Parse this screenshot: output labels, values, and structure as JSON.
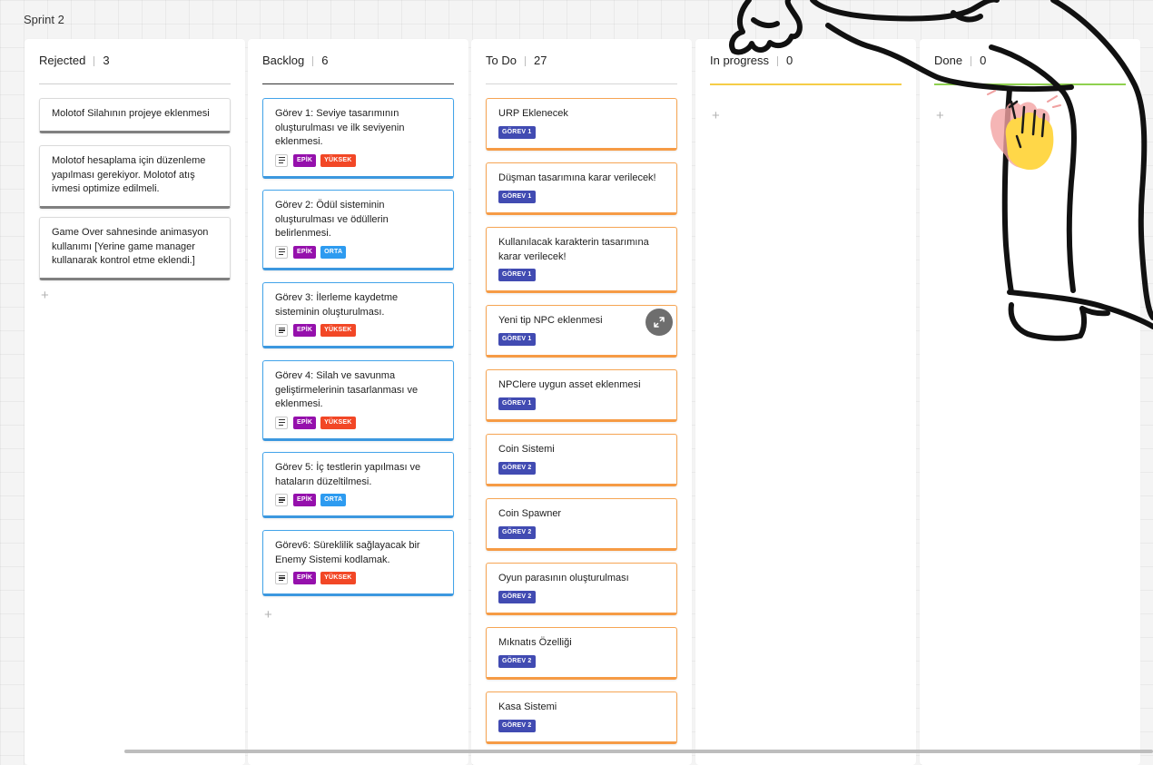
{
  "board": {
    "title": "Sprint 2"
  },
  "columns": [
    {
      "name": "Rejected",
      "count": "3",
      "cards": [
        {
          "title": "Molotof Silahının projeye eklenmesi"
        },
        {
          "title": "Molotof hesaplama için düzenleme yapılması gerekiyor. Molotof atış ivmesi optimize edilmeli."
        },
        {
          "title": "Game Over sahnesinde animasyon kullanımı [Yerine game manager kullanarak kontrol etme eklendi.]"
        }
      ]
    },
    {
      "name": "Backlog",
      "count": "6",
      "cards": [
        {
          "title": "Görev 1: Seviye tasarımının oluşturulması ve ilk seviyenin eklenmesi.",
          "tags": [
            "EPİK",
            "YÜKSEK"
          ]
        },
        {
          "title": "Görev 2: Ödül sisteminin oluşturulması ve ödüllerin belirlenmesi.",
          "tags": [
            "EPİK",
            "ORTA"
          ]
        },
        {
          "title": "Görev 3: İlerleme kaydetme sisteminin oluşturulması.",
          "tags": [
            "EPİK",
            "YÜKSEK"
          ]
        },
        {
          "title": "Görev 4: Silah ve savunma geliştirmelerinin tasarlanması ve eklenmesi.",
          "tags": [
            "EPİK",
            "YÜKSEK"
          ]
        },
        {
          "title": "Görev 5: İç testlerin yapılması ve hataların düzeltilmesi.",
          "tags": [
            "EPİK",
            "ORTA"
          ]
        },
        {
          "title": "Görev6: Süreklilik sağlayacak bir Enemy Sistemi kodlamak.",
          "tags": [
            "EPİK",
            "YÜKSEK"
          ]
        }
      ]
    },
    {
      "name": "To Do",
      "count": "27",
      "cards": [
        {
          "title": "URP Eklenecek",
          "tag": "GÖREV 1"
        },
        {
          "title": "Düşman tasarımına karar verilecek!",
          "tag": "GÖREV 1"
        },
        {
          "title": "Kullanılacak karakterin tasarımına karar verilecek!",
          "tag": "GÖREV 1"
        },
        {
          "title": "Yeni tip NPC eklenmesi",
          "tag": "GÖREV 1"
        },
        {
          "title": "NPClere uygun asset eklenmesi",
          "tag": "GÖREV 1"
        },
        {
          "title": "Coin Sistemi",
          "tag": "GÖREV 2"
        },
        {
          "title": "Coin Spawner",
          "tag": "GÖREV 2"
        },
        {
          "title": "Oyun parasının oluşturulması",
          "tag": "GÖREV 2"
        },
        {
          "title": "Mıknatıs Özelliği",
          "tag": "GÖREV 2"
        },
        {
          "title": "Kasa Sistemi",
          "tag": "GÖREV 2"
        }
      ]
    },
    {
      "name": "In progress",
      "count": "0",
      "cards": []
    },
    {
      "name": "Done",
      "count": "0",
      "cards": []
    }
  ],
  "add_symbol": "+",
  "icons": {
    "description": "description-lines-icon",
    "expand": "expand-arrows-icon",
    "doodle": "hand-drawn-character-doodle",
    "wave": "waving-hand-emoji"
  },
  "colors": {
    "epik": "#9510ac",
    "yuksek": "#f24726",
    "orta": "#2d9bf0",
    "gorev": "#414bb2",
    "backlog_card": "#3c98df",
    "todo_card": "#f69b45",
    "rejected_card": "#808080",
    "in_progress_line": "#f5cd47",
    "done_line": "#8fd14f"
  }
}
